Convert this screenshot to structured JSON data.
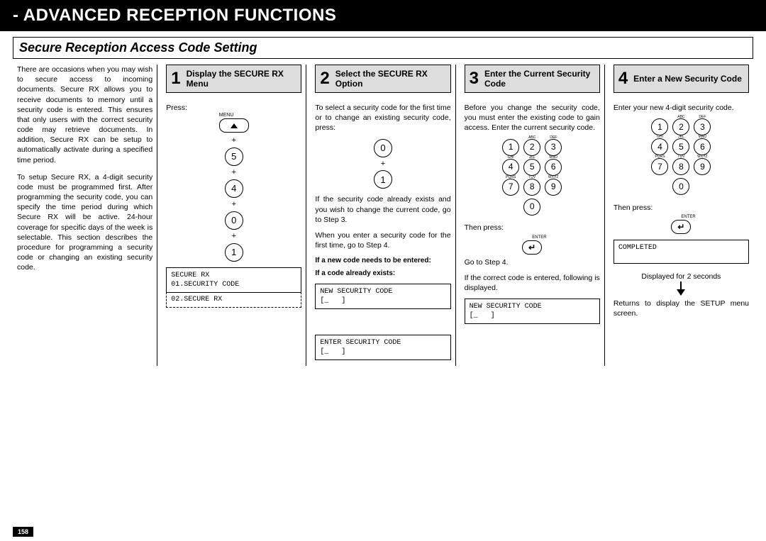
{
  "header": "- ADVANCED RECEPTION FUNCTIONS",
  "subtitle": "Secure Reception Access Code Setting",
  "page_number": "158",
  "intro": {
    "p1": "There are occasions when you may wish to secure access to incoming documents. Secure RX allows you to receive documents to memory until a security code is entered. This ensures that only users with the correct security code may retrieve documents. In addition, Secure RX can be setup to automatically activate during a specified time period.",
    "p2": "To setup Secure RX, a 4-digit security code must be programmed first. After programming the security code, you can specify the time period during which Secure RX will be active. 24-hour coverage for specific days of the week is selectable. This section describes the procedure for programming a security code or changing an existing security code."
  },
  "step1": {
    "num": "1",
    "title": "Display the SECURE RX Menu",
    "press": "Press:",
    "menu_label": "MENU",
    "keys": [
      "5",
      "4",
      "0",
      "1"
    ],
    "lcd_a": "SECURE RX\n01.SECURITY CODE",
    "lcd_b": "02.SECURE RX"
  },
  "step2": {
    "num": "2",
    "title": "Select the SECURE RX Option",
    "p1": "To select a security code for the first time or to change an existing security code, press:",
    "keys": [
      "0",
      "1"
    ],
    "p2": "If the security code already exists and you wish to change the current code, go to Step 3.",
    "p3": "When you enter a security code for the first time, go to Step 4.",
    "b1": "If a new code needs to be entered:",
    "b2": "If a code already exists:",
    "lcd_a": "NEW SECURITY CODE\n[_   ]",
    "lcd_b": "ENTER SECURITY CODE\n[_   ]"
  },
  "step3": {
    "num": "3",
    "title": "Enter the Current Security Code",
    "p1": "Before you change the security code, you must enter the existing code to gain access. Enter the current security code.",
    "then_press": "Then press:",
    "enter_label": "ENTER",
    "p2": "Go to Step 4.",
    "p3": "If the correct code is entered, following is displayed.",
    "lcd_a": "NEW SECURITY CODE\n[_   ]"
  },
  "step4": {
    "num": "4",
    "title": "Enter a New Security Code",
    "p1": "Enter your new 4-digit security code.",
    "then_press": "Then press:",
    "enter_label": "ENTER",
    "lcd_a": "COMPLETED",
    "p2": "Displayed for 2 seconds",
    "p3": "Returns to display the SETUP menu screen."
  },
  "keypad": {
    "rows": [
      [
        {
          "n": "1",
          "l": ""
        },
        {
          "n": "2",
          "l": "ABC"
        },
        {
          "n": "3",
          "l": "DEF"
        }
      ],
      [
        {
          "n": "4",
          "l": "GHI"
        },
        {
          "n": "5",
          "l": "JKL"
        },
        {
          "n": "6",
          "l": "MNO"
        }
      ],
      [
        {
          "n": "7",
          "l": "PQRS"
        },
        {
          "n": "8",
          "l": "TUV"
        },
        {
          "n": "9",
          "l": "WXYZ"
        }
      ],
      [
        {
          "n": "0",
          "l": ""
        }
      ]
    ]
  }
}
